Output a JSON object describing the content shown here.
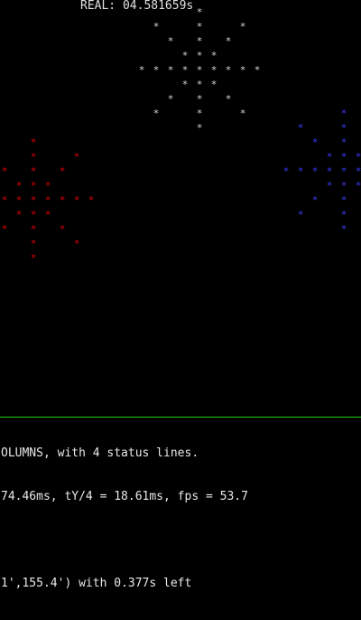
{
  "terminal": {
    "real_label": "REAL: 04.581659s",
    "status": {
      "line_1": "OLUMNS, with 4 status lines.",
      "line_2": "74.46ms, tY/4 = 18.61ms, fps = 53.7",
      "line_3": "",
      "line_4": "1',155.4') with 0.377s left"
    },
    "glyph": "*",
    "colors": {
      "background": "#000000",
      "text": "#e8e8e8",
      "gray": "#d7d7d7",
      "red": "#e30000",
      "blue": "#3c3cff",
      "divider": "#22d11d"
    }
  }
}
